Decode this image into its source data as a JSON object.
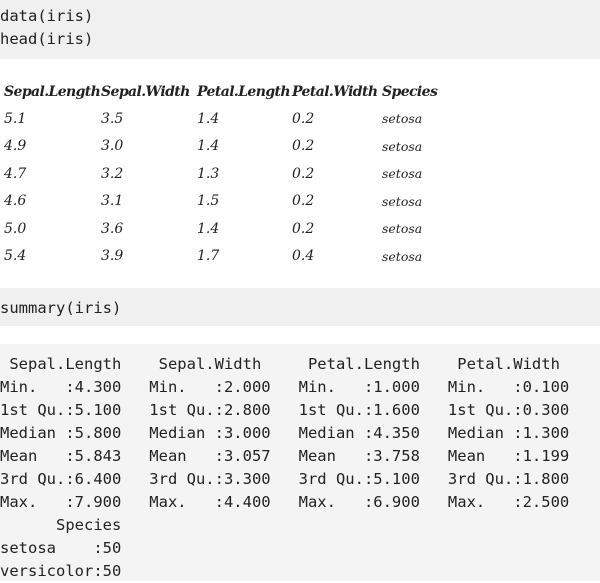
{
  "code_blocks": {
    "block1": "data(iris)\nhead(iris)",
    "block2": "summary(iris)"
  },
  "head_table": {
    "headers": [
      "Sepal.Length",
      "Sepal.Width",
      "Petal.Length",
      "Petal.Width",
      "Species"
    ],
    "rows": [
      [
        "5.1",
        "3.5",
        "1.4",
        "0.2",
        "setosa"
      ],
      [
        "4.9",
        "3.0",
        "1.4",
        "0.2",
        "setosa"
      ],
      [
        "4.7",
        "3.2",
        "1.3",
        "0.2",
        "setosa"
      ],
      [
        "4.6",
        "3.1",
        "1.5",
        "0.2",
        "setosa"
      ],
      [
        "5.0",
        "3.6",
        "1.4",
        "0.2",
        "setosa"
      ],
      [
        "5.4",
        "3.9",
        "1.7",
        "0.4",
        "setosa"
      ]
    ]
  },
  "summary_output": " Sepal.Length    Sepal.Width     Petal.Length    Petal.Width   \nMin.   :4.300   Min.   :2.000   Min.   :1.000   Min.   :0.100  \n1st Qu.:5.100   1st Qu.:2.800   1st Qu.:1.600   1st Qu.:0.300  \nMedian :5.800   Median :3.000   Median :4.350   Median :1.300  \nMean   :5.843   Mean   :3.057   Mean   :3.758   Mean   :1.199  \n3rd Qu.:6.400   3rd Qu.:3.300   3rd Qu.:5.100   3rd Qu.:1.800  \nMax.   :7.900   Max.   :4.400   Max.   :6.900   Max.   :2.500  \n      Species  \nsetosa    :50  \nversicolor:50  "
}
